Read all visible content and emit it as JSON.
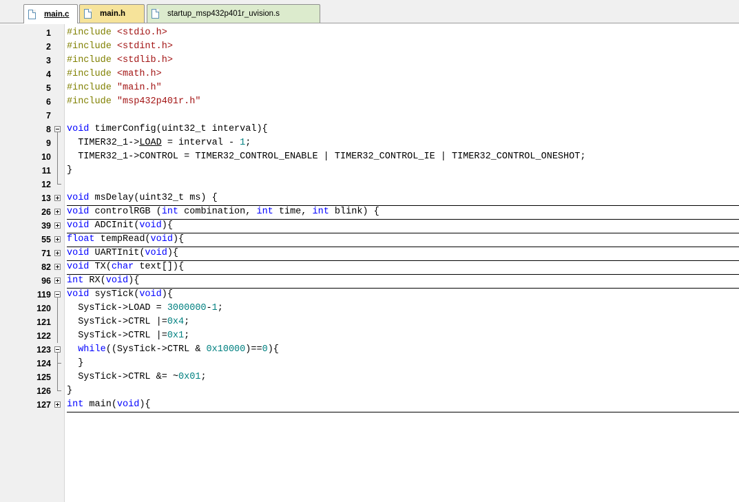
{
  "tabs": [
    {
      "label": "main.c",
      "active": true
    },
    {
      "label": "main.h",
      "active": false
    },
    {
      "label": "startup_msp432p401r_uvision.s",
      "active": false
    }
  ],
  "colors": {
    "keyword": "#0000ff",
    "preprocessor": "#808000",
    "string": "#a31515",
    "number": "#008080",
    "gutter": "#f0f0f0",
    "tab_h": "#f6e39a",
    "tab_s": "#dcebcd"
  },
  "lines": [
    {
      "n": "1",
      "fold": "none",
      "tokens": [
        {
          "t": "#include ",
          "c": "pp"
        },
        {
          "t": "<stdio.h>",
          "c": "str"
        }
      ]
    },
    {
      "n": "2",
      "fold": "none",
      "tokens": [
        {
          "t": "#include ",
          "c": "pp"
        },
        {
          "t": "<stdint.h>",
          "c": "str"
        }
      ]
    },
    {
      "n": "3",
      "fold": "none",
      "tokens": [
        {
          "t": "#include ",
          "c": "pp"
        },
        {
          "t": "<stdlib.h>",
          "c": "str"
        }
      ]
    },
    {
      "n": "4",
      "fold": "none",
      "tokens": [
        {
          "t": "#include ",
          "c": "pp"
        },
        {
          "t": "<math.h>",
          "c": "str"
        }
      ]
    },
    {
      "n": "5",
      "fold": "none",
      "tokens": [
        {
          "t": "#include ",
          "c": "pp"
        },
        {
          "t": "\"main.h\"",
          "c": "str"
        }
      ]
    },
    {
      "n": "6",
      "fold": "none",
      "tokens": [
        {
          "t": "#include ",
          "c": "pp"
        },
        {
          "t": "\"msp432p401r.h\"",
          "c": "str"
        }
      ]
    },
    {
      "n": "7",
      "fold": "none",
      "tokens": []
    },
    {
      "n": "8",
      "fold": "open",
      "tokens": [
        {
          "t": "void",
          "c": "kw"
        },
        {
          "t": " timerConfig(uint32_t interval){"
        }
      ]
    },
    {
      "n": "9",
      "fold": "inner",
      "tokens": [
        {
          "t": "  TIMER32_1->"
        },
        {
          "t": "LOAD",
          "c": "ul"
        },
        {
          "t": " = interval - "
        },
        {
          "t": "1",
          "c": "num"
        },
        {
          "t": ";"
        }
      ]
    },
    {
      "n": "10",
      "fold": "inner",
      "tokens": [
        {
          "t": "  TIMER32_1->CONTROL = TIMER32_CONTROL_ENABLE | TIMER32_CONTROL_IE | TIMER32_CONTROL_ONESHOT;"
        }
      ]
    },
    {
      "n": "11",
      "fold": "inner",
      "tokens": [
        {
          "t": "}"
        }
      ]
    },
    {
      "n": "12",
      "fold": "end",
      "tokens": []
    },
    {
      "n": "13",
      "fold": "closed",
      "tokens": [
        {
          "t": "void",
          "c": "kw"
        },
        {
          "t": " msDelay(uint32_t ms) {"
        }
      ]
    },
    {
      "n": "26",
      "fold": "closed",
      "tokens": [
        {
          "t": "void",
          "c": "kw"
        },
        {
          "t": " controlRGB ("
        },
        {
          "t": "int",
          "c": "kw"
        },
        {
          "t": " combination, "
        },
        {
          "t": "int",
          "c": "kw"
        },
        {
          "t": " time, "
        },
        {
          "t": "int",
          "c": "kw"
        },
        {
          "t": " blink) {"
        }
      ]
    },
    {
      "n": "39",
      "fold": "closed",
      "tokens": [
        {
          "t": "void",
          "c": "kw"
        },
        {
          "t": " ADCInit("
        },
        {
          "t": "void",
          "c": "kw"
        },
        {
          "t": "){"
        }
      ]
    },
    {
      "n": "55",
      "fold": "closed",
      "tokens": [
        {
          "t": "float",
          "c": "kw"
        },
        {
          "t": " tempRead("
        },
        {
          "t": "void",
          "c": "kw"
        },
        {
          "t": "){"
        }
      ]
    },
    {
      "n": "71",
      "fold": "closed",
      "tokens": [
        {
          "t": "void",
          "c": "kw"
        },
        {
          "t": " UARTInit("
        },
        {
          "t": "void",
          "c": "kw"
        },
        {
          "t": "){"
        }
      ]
    },
    {
      "n": "82",
      "fold": "closed",
      "tokens": [
        {
          "t": "void",
          "c": "kw"
        },
        {
          "t": " TX("
        },
        {
          "t": "char",
          "c": "kw"
        },
        {
          "t": " text[]){"
        }
      ]
    },
    {
      "n": "96",
      "fold": "closed",
      "tokens": [
        {
          "t": "int",
          "c": "kw"
        },
        {
          "t": " RX("
        },
        {
          "t": "void",
          "c": "kw"
        },
        {
          "t": "){"
        }
      ]
    },
    {
      "n": "119",
      "fold": "open",
      "tokens": [
        {
          "t": "void",
          "c": "kw"
        },
        {
          "t": " sysTick("
        },
        {
          "t": "void",
          "c": "kw"
        },
        {
          "t": "){"
        }
      ]
    },
    {
      "n": "120",
      "fold": "inner",
      "tokens": [
        {
          "t": "  SysTick->LOAD = "
        },
        {
          "t": "3000000",
          "c": "num"
        },
        {
          "t": "-"
        },
        {
          "t": "1",
          "c": "num"
        },
        {
          "t": ";"
        }
      ]
    },
    {
      "n": "121",
      "fold": "inner",
      "tokens": [
        {
          "t": "  SysTick->CTRL |="
        },
        {
          "t": "0x4",
          "c": "num"
        },
        {
          "t": ";"
        }
      ]
    },
    {
      "n": "122",
      "fold": "inner",
      "tokens": [
        {
          "t": "  SysTick->CTRL |="
        },
        {
          "t": "0x1",
          "c": "num"
        },
        {
          "t": ";"
        }
      ]
    },
    {
      "n": "123",
      "fold": "open2",
      "tokens": [
        {
          "t": "  "
        },
        {
          "t": "while",
          "c": "kw"
        },
        {
          "t": "((SysTick->CTRL & "
        },
        {
          "t": "0x10000",
          "c": "num"
        },
        {
          "t": ")=="
        },
        {
          "t": "0",
          "c": "num"
        },
        {
          "t": "){"
        }
      ]
    },
    {
      "n": "124",
      "fold": "tee",
      "tokens": [
        {
          "t": "  }"
        }
      ]
    },
    {
      "n": "125",
      "fold": "inner",
      "tokens": [
        {
          "t": "  SysTick->CTRL &= ~"
        },
        {
          "t": "0x01",
          "c": "num"
        },
        {
          "t": ";"
        }
      ]
    },
    {
      "n": "126",
      "fold": "end",
      "tokens": [
        {
          "t": "}"
        }
      ]
    },
    {
      "n": "127",
      "fold": "closed",
      "tokens": [
        {
          "t": "int",
          "c": "kw"
        },
        {
          "t": " main("
        },
        {
          "t": "void",
          "c": "kw"
        },
        {
          "t": "){"
        }
      ]
    }
  ]
}
